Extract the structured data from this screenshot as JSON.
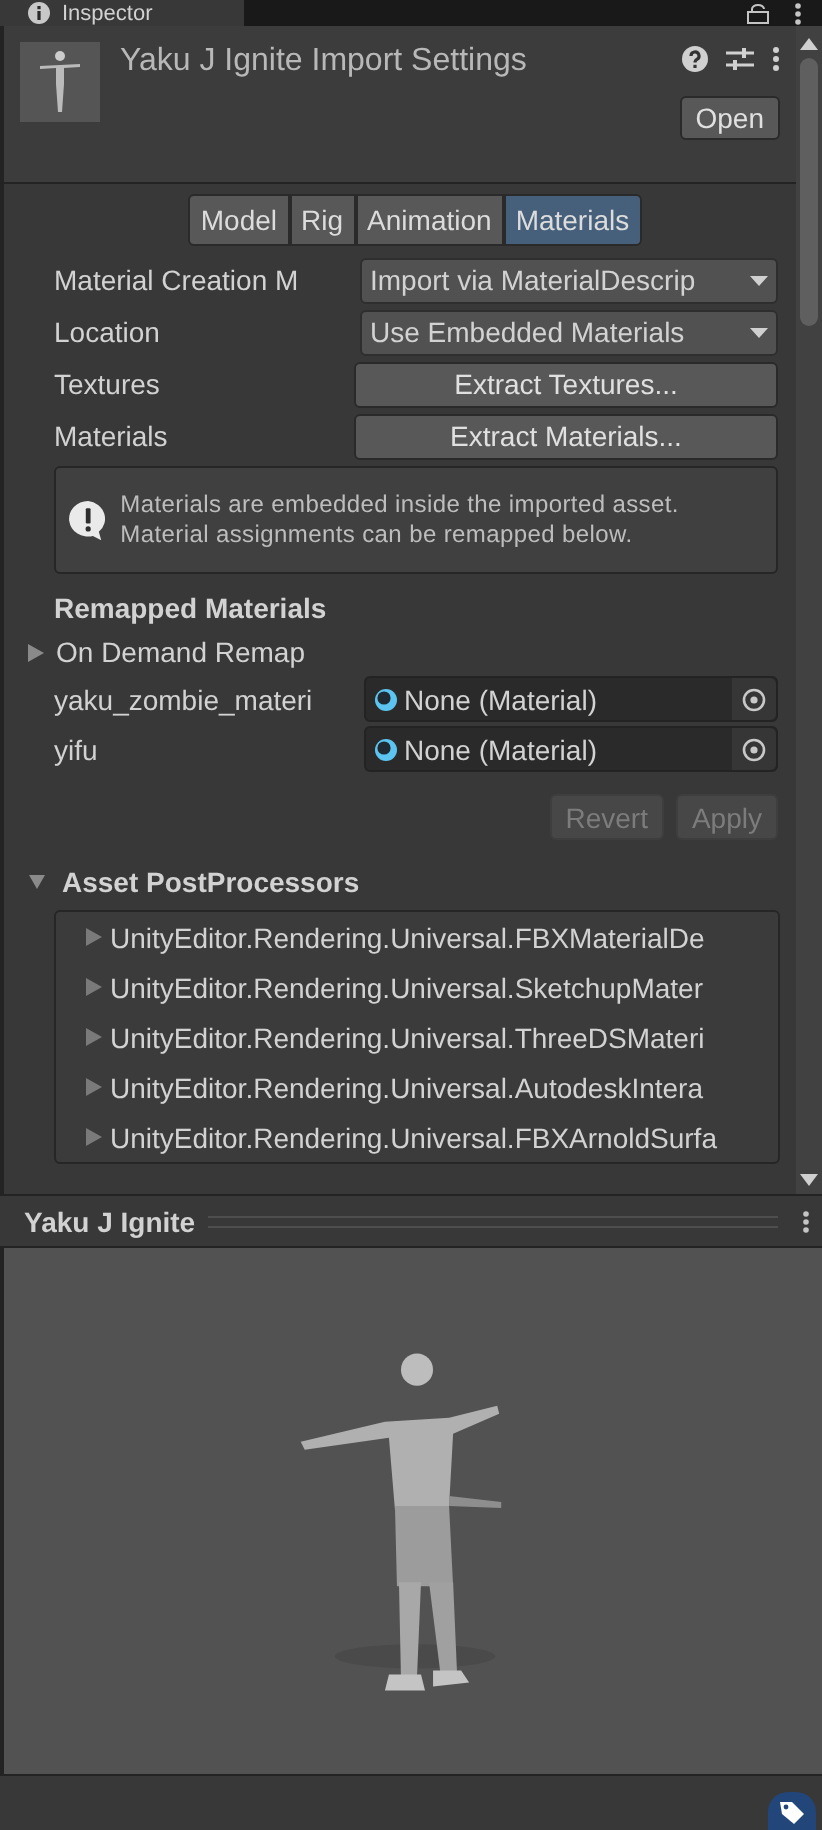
{
  "window": {
    "title": "Inspector"
  },
  "header": {
    "title": "Yaku J Ignite Import Settings",
    "open_button": "Open"
  },
  "tabs": [
    {
      "label": "Model",
      "selected": false
    },
    {
      "label": "Rig",
      "selected": false
    },
    {
      "label": "Animation",
      "selected": false
    },
    {
      "label": "Materials",
      "selected": true
    }
  ],
  "fields": [
    {
      "kind": "dropdown",
      "label": "Material Creation M",
      "value": "Import via MaterialDescrip"
    },
    {
      "kind": "dropdown",
      "label": "Location",
      "value": "Use Embedded Materials"
    },
    {
      "kind": "button",
      "label": "Textures",
      "value": "Extract Textures..."
    },
    {
      "kind": "button",
      "label": "Materials",
      "value": "Extract Materials..."
    }
  ],
  "help_box": {
    "text": "Materials are embedded inside the imported asset. Material assignments can be remapped below."
  },
  "remapped": {
    "title": "Remapped Materials",
    "on_demand": {
      "label": "On Demand Remap",
      "expanded": false
    },
    "slots": [
      {
        "name": "yaku_zombie_materi",
        "value": "None (Material)"
      },
      {
        "name": "yifu",
        "value": "None (Material)"
      }
    ]
  },
  "buttons": [
    {
      "label": "Revert",
      "disabled": true
    },
    {
      "label": "Apply",
      "disabled": true
    }
  ],
  "post_processors": {
    "title": "Asset PostProcessors",
    "expanded": true,
    "items": [
      {
        "label": "UnityEditor.Rendering.Universal.FBXMaterialDe",
        "expanded": false
      },
      {
        "label": "UnityEditor.Rendering.Universal.SketchupMater",
        "expanded": false
      },
      {
        "label": "UnityEditor.Rendering.Universal.ThreeDSMateri",
        "expanded": false
      },
      {
        "label": "UnityEditor.Rendering.Universal.AutodeskIntera",
        "expanded": false
      },
      {
        "label": "UnityEditor.Rendering.Universal.FBXArnoldSurfa",
        "expanded": false
      }
    ]
  },
  "preview": {
    "title": "Yaku J Ignite"
  }
}
